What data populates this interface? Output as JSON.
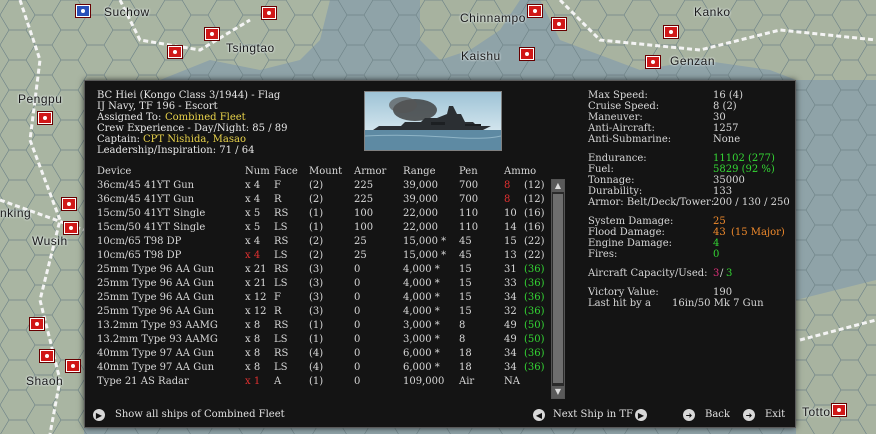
{
  "map": {
    "labels": [
      "Suchow",
      "Chinnampo",
      "Kanko",
      "Tsingtao",
      "Kaishu",
      "Genzan",
      "Pengpu",
      "nking",
      "Wusih",
      "Shaoh",
      "Tottori"
    ],
    "marker_color": "#d01818"
  },
  "ship": {
    "name_line": "BC Hiei (Kongo Class 3/1944) - Flag",
    "navy_line": "IJ Navy, TF 196 - Escort",
    "assigned_label": "Assigned To:",
    "assigned_value": "Combined Fleet",
    "crew_line": "Crew Experience - Day/Night: 85 / 89",
    "captain_label": "Captain:",
    "captain_value": "CPT Nishida, Masao",
    "leadership_line": "Leadership/Inspiration: 71 / 64"
  },
  "devices": {
    "headers": {
      "device": "Device",
      "num": "Num",
      "face": "Face",
      "mount": "Mount",
      "armor": "Armor",
      "range": "Range",
      "pen": "Pen",
      "ammo": "Ammo"
    },
    "rows": [
      {
        "device": "36cm/45 41YT Gun",
        "num": "x 4",
        "face": "F",
        "mount": "(2)",
        "armor": "225",
        "range": "39,000",
        "pen": "700",
        "ammo": "8",
        "ammo2": "(12)",
        "num_color": "",
        "ammo_color": "#e03030"
      },
      {
        "device": "36cm/45 41YT Gun",
        "num": "x 4",
        "face": "R",
        "mount": "(2)",
        "armor": "225",
        "range": "39,000",
        "pen": "700",
        "ammo": "8",
        "ammo2": "(12)",
        "num_color": "",
        "ammo_color": "#e03030"
      },
      {
        "device": "15cm/50 41YT Single",
        "num": "x 5",
        "face": "RS",
        "mount": "(1)",
        "armor": "100",
        "range": "22,000",
        "pen": "110",
        "ammo": "10",
        "ammo2": "(16)",
        "num_color": "",
        "ammo_color": ""
      },
      {
        "device": "15cm/50 41YT Single",
        "num": "x 5",
        "face": "LS",
        "mount": "(1)",
        "armor": "100",
        "range": "22,000",
        "pen": "110",
        "ammo": "14",
        "ammo2": "(16)",
        "num_color": "",
        "ammo_color": ""
      },
      {
        "device": "10cm/65 T98 DP",
        "num": "x 4",
        "face": "RS",
        "mount": "(2)",
        "armor": "25",
        "range": "15,000 *",
        "pen": "45",
        "ammo": "15",
        "ammo2": "(22)",
        "num_color": "",
        "ammo_color": ""
      },
      {
        "device": "10cm/65 T98 DP",
        "num": "x 4",
        "face": "LS",
        "mount": "(2)",
        "armor": "25",
        "range": "15,000 *",
        "pen": "45",
        "ammo": "13",
        "ammo2": "(22)",
        "num_color": "#e03030",
        "ammo_color": ""
      },
      {
        "device": "25mm Type 96 AA Gun",
        "num": "x 21",
        "face": "RS",
        "mount": "(3)",
        "armor": "0",
        "range": "4,000 *",
        "pen": "15",
        "ammo": "31",
        "ammo2": "(36)",
        "num_color": "",
        "ammo_color": ""
      },
      {
        "device": "25mm Type 96 AA Gun",
        "num": "x 21",
        "face": "LS",
        "mount": "(3)",
        "armor": "0",
        "range": "4,000 *",
        "pen": "15",
        "ammo": "33",
        "ammo2": "(36)",
        "num_color": "",
        "ammo_color": ""
      },
      {
        "device": "25mm Type 96 AA Gun",
        "num": "x 12",
        "face": "F",
        "mount": "(3)",
        "armor": "0",
        "range": "4,000 *",
        "pen": "15",
        "ammo": "34",
        "ammo2": "(36)",
        "num_color": "",
        "ammo_color": ""
      },
      {
        "device": "25mm Type 96 AA Gun",
        "num": "x 12",
        "face": "R",
        "mount": "(3)",
        "armor": "0",
        "range": "4,000 *",
        "pen": "15",
        "ammo": "32",
        "ammo2": "(36)",
        "num_color": "",
        "ammo_color": ""
      },
      {
        "device": "13.2mm Type 93 AAMG",
        "num": "x 8",
        "face": "RS",
        "mount": "(1)",
        "armor": "0",
        "range": "3,000 *",
        "pen": "8",
        "ammo": "49",
        "ammo2": "(50)",
        "num_color": "",
        "ammo_color": ""
      },
      {
        "device": "13.2mm Type 93 AAMG",
        "num": "x 8",
        "face": "LS",
        "mount": "(1)",
        "armor": "0",
        "range": "3,000 *",
        "pen": "8",
        "ammo": "49",
        "ammo2": "(50)",
        "num_color": "",
        "ammo_color": ""
      },
      {
        "device": "40mm Type 97 AA Gun",
        "num": "x 8",
        "face": "RS",
        "mount": "(4)",
        "armor": "0",
        "range": "6,000 *",
        "pen": "18",
        "ammo": "34",
        "ammo2": "(36)",
        "num_color": "",
        "ammo_color": ""
      },
      {
        "device": "40mm Type 97 AA Gun",
        "num": "x 8",
        "face": "LS",
        "mount": "(4)",
        "armor": "0",
        "range": "6,000 *",
        "pen": "18",
        "ammo": "34",
        "ammo2": "(36)",
        "num_color": "",
        "ammo_color": ""
      },
      {
        "device": "Type 21 AS Radar",
        "num": "x 1",
        "face": "A",
        "mount": "(1)",
        "armor": "0",
        "range": "109,000",
        "pen": "Air",
        "ammo": "NA",
        "ammo2": "",
        "num_color": "#e03030",
        "ammo_color": ""
      }
    ]
  },
  "stats": {
    "max_speed": {
      "label": "Max Speed:",
      "value": "16 (4)"
    },
    "cruise_speed": {
      "label": "Cruise Speed:",
      "value": "8 (2)"
    },
    "maneuver": {
      "label": "Maneuver:",
      "value": "30"
    },
    "anti_aircraft": {
      "label": "Anti-Aircraft:",
      "value": "1257"
    },
    "anti_submarine": {
      "label": "Anti-Submarine:",
      "value": "None"
    },
    "endurance": {
      "label": "Endurance:",
      "value": "11102 (277)"
    },
    "fuel": {
      "label": "Fuel:",
      "value": "5829 (92 %)"
    },
    "tonnage": {
      "label": "Tonnage:",
      "value": "35000"
    },
    "durability": {
      "label": "Durability:",
      "value": "133"
    },
    "armor": {
      "label": "Armor: Belt/Deck/Tower:",
      "value": "200 / 130 / 250"
    },
    "system_damage": {
      "label": "System Damage:",
      "value": "25"
    },
    "flood_damage": {
      "label": "Flood Damage:",
      "value": "43",
      "extra": "(15 Major)"
    },
    "engine_damage": {
      "label": "Engine Damage:",
      "value": "4"
    },
    "fires": {
      "label": "Fires:",
      "value": "0"
    },
    "aircraft": {
      "label": "Aircraft Capacity/Used:",
      "value_a": "3",
      "sep": "/",
      "value_b": "3"
    },
    "victory": {
      "label": "Victory Value:",
      "value": "190"
    },
    "last_hit": {
      "label": "Last hit by a",
      "value": "16in/50 Mk 7 Gun"
    }
  },
  "footer": {
    "show_all": "Show all ships of Combined Fleet",
    "next_ship": "Next Ship in TF",
    "back": "Back",
    "exit": "Exit"
  },
  "colors": {
    "panel_bg": "#141414",
    "highlight": "#e8d24a",
    "good": "#34d634",
    "warn": "#f08a2c",
    "bad": "#e03030"
  }
}
